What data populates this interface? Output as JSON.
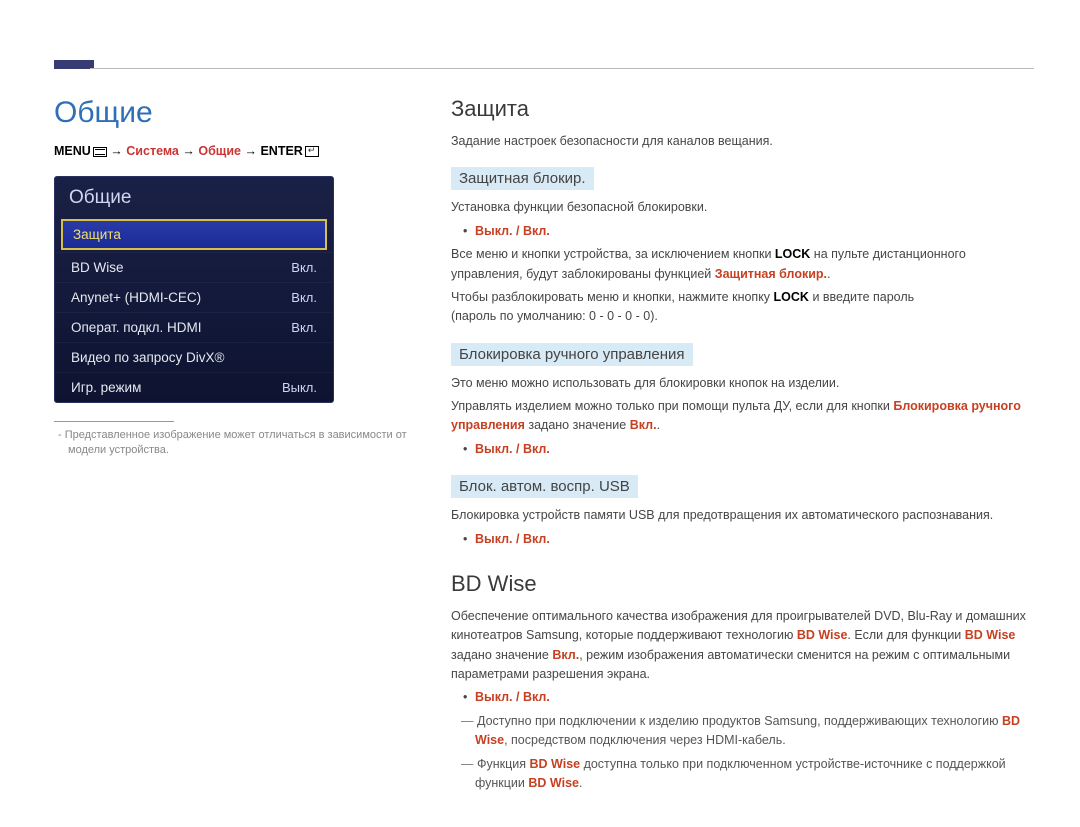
{
  "page_title": "Общие",
  "breadcrumb": {
    "menu": "MENU",
    "sys": "Система",
    "general": "Общие",
    "enter": "ENTER"
  },
  "osd": {
    "title": "Общие",
    "items": [
      {
        "label": "Защита",
        "value": "",
        "selected": true
      },
      {
        "label": "BD Wise",
        "value": "Вкл."
      },
      {
        "label": "Anynet+ (HDMI-CEC)",
        "value": "Вкл."
      },
      {
        "label": "Операт. подкл. HDMI",
        "value": "Вкл."
      },
      {
        "label": "Видео по запросу DivX®",
        "value": ""
      },
      {
        "label": "Игр. режим",
        "value": "Выкл."
      }
    ]
  },
  "footnote": "Представленное изображение может отличаться в зависимости от модели устройства.",
  "security": {
    "heading": "Защита",
    "intro": "Задание настроек безопасности для каналов вещания.",
    "safety_lock": {
      "heading": "Защитная блокир.",
      "line1": "Установка функции безопасной блокировки.",
      "toggle": "Выкл. / Вкл.",
      "line2a": "Все меню и кнопки устройства, за исключением кнопки ",
      "lock": "LOCK",
      "line2b": " на пульте дистанционного управления, будут заблокированы функцией ",
      "red1": "Защитная блокир.",
      "line3a": "Чтобы разблокировать меню и кнопки, нажмите кнопку ",
      "line3b": " и введите пароль",
      "pwd": "(пароль по умолчанию: 0 - 0 - 0 - 0)."
    },
    "manual_lock": {
      "heading": "Блокировка ручного управления",
      "line1": "Это меню можно использовать для блокировки кнопок на изделии.",
      "line2a": "Управлять изделием можно только при помощи пульта ДУ, если для кнопки ",
      "red1": "Блокировка ручного управления",
      "line2b": " задано значение ",
      "red2": "Вкл.",
      "toggle": "Выкл. / Вкл."
    },
    "usb_lock": {
      "heading": "Блок. автом. воспр. USB",
      "line1": "Блокировка устройств памяти USB для предотвращения их автоматического распознавания.",
      "toggle": "Выкл. / Вкл."
    }
  },
  "bdwise": {
    "heading": "BD Wise",
    "p1a": "Обеспечение оптимального качества изображения для проигрывателей DVD, Blu-Ray и домашних кинотеатров Samsung, которые поддерживают технологию ",
    "r1": "BD Wise",
    "p1b": ". Если для функции ",
    "r2": "BD Wise",
    "p1c": " задано значение ",
    "r3": "Вкл.",
    "p1d": ", режим изображения автоматически сменится на режим с оптимальными параметрами разрешения экрана.",
    "toggle": "Выкл. / Вкл.",
    "note1a": "Доступно при подключении к изделию продуктов Samsung, поддерживающих технологию ",
    "note1b": ", посредством подключения через HDMI-кабель.",
    "note2a": "Функция ",
    "note2b": " доступна только при подключенном устройстве-источнике с поддержкой функции ",
    "r4": "BD Wise"
  }
}
